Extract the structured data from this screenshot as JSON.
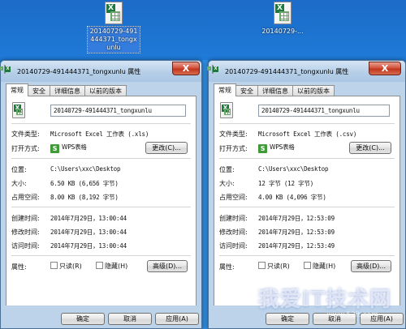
{
  "desktop": {
    "icons": [
      {
        "label": "20140729-491444371_tongxunlu",
        "selected": true
      },
      {
        "label": "20140729-...",
        "selected": false
      }
    ]
  },
  "left_window": {
    "title": "20140729-491444371_tongxunlu 属性",
    "close": "X",
    "tabs": [
      "常规",
      "安全",
      "详细信息",
      "以前的版本"
    ],
    "filename": "20140729-491444371_tongxunlu",
    "file_type_label": "文件类型:",
    "file_type_value": "Microsoft Excel 工作表 (.xls)",
    "open_with_label": "打开方式:",
    "open_with_app": "WPS表格",
    "change_button": "更改(C)...",
    "location_label": "位置:",
    "location_value": "C:\\Users\\xxc\\Desktop",
    "size_label": "大小:",
    "size_value": "6.50 KB (6,656 字节)",
    "disk_size_label": "占用空间:",
    "disk_size_value": "8.00 KB (8,192 字节)",
    "created_label": "创建时间:",
    "created_value": "2014年7月29日，13:00:44",
    "modified_label": "修改时间:",
    "modified_value": "2014年7月29日，13:00:44",
    "accessed_label": "访问时间:",
    "accessed_value": "2014年7月29日，13:00:44",
    "attributes_label": "属性:",
    "readonly_label": "只读(R)",
    "hidden_label": "隐藏(H)",
    "advanced_button": "高级(D)...",
    "ok_button": "确定",
    "cancel_button": "取消",
    "apply_button": "应用(A)"
  },
  "right_window": {
    "title": "20140729-491444371_tongxunlu 属性",
    "close": "X",
    "tabs": [
      "常规",
      "安全",
      "详细信息",
      "以前的版本"
    ],
    "filename": "20140729-491444371_tongxunlu",
    "file_type_label": "文件类型:",
    "file_type_value": "Microsoft Excel 工作表 (.csv)",
    "open_with_label": "打开方式:",
    "open_with_app": "WPS表格",
    "change_button": "更改(C)...",
    "location_label": "位置:",
    "location_value": "C:\\Users\\xxc\\Desktop",
    "size_label": "大小:",
    "size_value": "12 字节 (12 字节)",
    "disk_size_label": "占用空间:",
    "disk_size_value": "4.00 KB (4,096 字节)",
    "created_label": "创建时间:",
    "created_value": "2014年7月29日，12:53:09",
    "modified_label": "修改时间:",
    "modified_value": "2014年7月29日，12:53:09",
    "accessed_label": "访问时间:",
    "accessed_value": "2014年7月29日，12:53:49",
    "attributes_label": "属性:",
    "readonly_label": "只读(R)",
    "hidden_label": "隐藏(H)",
    "advanced_button": "高级(D)...",
    "ok_button": "确定",
    "cancel_button": "取消",
    "apply_button": "应用(A)"
  },
  "watermark": {
    "text": "我爱IT技术网",
    "sub": "www.52it.com"
  },
  "colors": {
    "accent": "#1f7ad8",
    "excel_green": "#1d7a3a",
    "wps_green": "#3e9b37",
    "close_red": "#c2351d"
  }
}
